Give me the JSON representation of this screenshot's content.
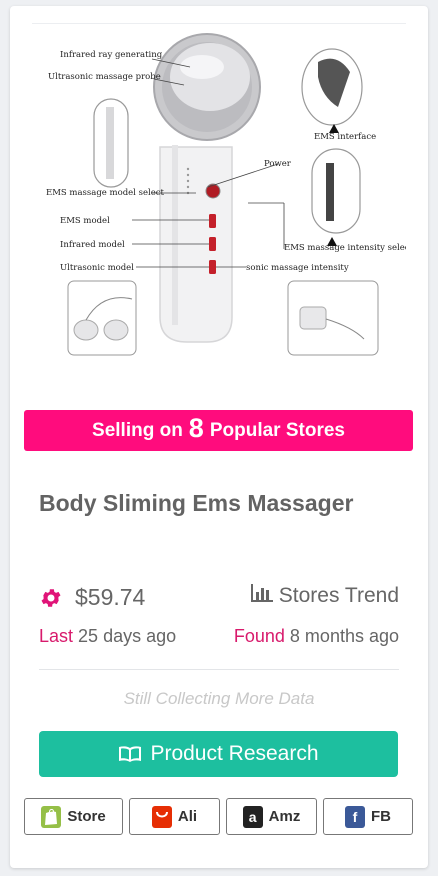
{
  "banner": {
    "prefix": "Selling on",
    "count": "8",
    "suffix": "Popular Stores"
  },
  "product": {
    "title": "Body Sliming Ems Massager",
    "price": "$59.74",
    "trend_label": "Stores Trend",
    "last_label": "Last",
    "last_value": "25 days ago",
    "found_label": "Found",
    "found_value": "8 months ago",
    "collecting_note": "Still Collecting More Data"
  },
  "diagram": {
    "labels": {
      "infrared": "Infrared ray generating",
      "ultrasonic_probe": "Ultrasonic massage probe",
      "ems_interface": "EMS interface",
      "power": "Power",
      "ems_model_select": "EMS massage model select",
      "ems_model": "EMS model",
      "infrared_model": "Infrared model",
      "ultrasonic_model": "Ultrasonic model",
      "ems_intensity_select": "EMS massage intensity select",
      "sonic_intensity": "sonic massage intensity"
    }
  },
  "actions": {
    "research_label": "Product Research"
  },
  "stores": [
    {
      "label": "Store",
      "icon": "shopify-icon",
      "color": "#95bf47"
    },
    {
      "label": "Ali",
      "icon": "aliexpress-icon",
      "color": "#e62e04"
    },
    {
      "label": "Amz",
      "icon": "amazon-icon",
      "color": "#222222"
    },
    {
      "label": "FB",
      "icon": "facebook-icon",
      "color": "#3b5998"
    }
  ],
  "colors": {
    "accent": "#ff0c7d",
    "research": "#1dbf9f",
    "gear": "#e01478"
  }
}
